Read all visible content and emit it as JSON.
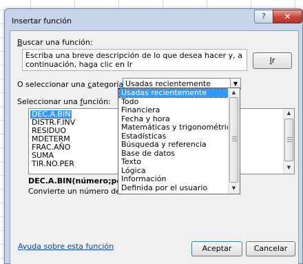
{
  "dialog": {
    "title": "Insertar función",
    "help_glyph": "?",
    "close_glyph": "✕"
  },
  "search": {
    "label": "Buscar una función:",
    "text": "Escriba una breve descripción de lo que desea hacer y, a continuación, haga clic en Ir",
    "go_button": "Ir"
  },
  "category": {
    "label": "O seleccionar una categoría:",
    "selected": "Usadas recientemente",
    "options": [
      "Usadas recientemente",
      "Todo",
      "Financiera",
      "Fecha y hora",
      "Matemáticas y trigonométricas",
      "Estadísticas",
      "Búsqueda y referencia",
      "Base de datos",
      "Texto",
      "Lógica",
      "Información",
      "Definida por el usuario"
    ]
  },
  "functions": {
    "label": "Seleccionar una función:",
    "items": [
      "DEC.A.BIN",
      "DISTR.F.INV",
      "RESIDUO",
      "MDETERM",
      "FRAC.AÑO",
      "SUMA",
      "TIR.NO.PER"
    ],
    "selected_index": 0
  },
  "signature": "DEC.A.BIN(número;posició",
  "description": "Convierte un número decimal",
  "footer": {
    "help_link": "Ayuda sobre esta función",
    "ok": "Aceptar",
    "cancel": "Cancelar"
  }
}
